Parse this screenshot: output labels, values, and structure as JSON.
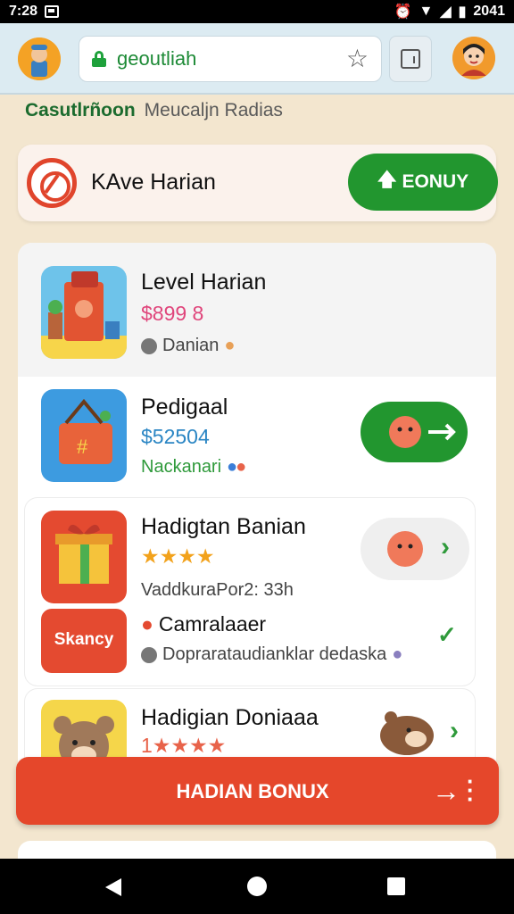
{
  "status_bar": {
    "time": "7:28",
    "right_text": "2041"
  },
  "browser": {
    "url": "geoutliah"
  },
  "site_heading": {
    "part1": "Casutlrñoon",
    "part2": "Meucaljn Radias"
  },
  "daily_card": {
    "title": "KAve Harian",
    "button_label": "EONUY"
  },
  "items": [
    {
      "title": "Level Harian",
      "price": "$899 8",
      "meta": "Danian"
    },
    {
      "title": "Pedigaal",
      "price": "$52504",
      "meta": "Nackanari"
    },
    {
      "title": "Hadigtan Banian",
      "rating": "★★★★",
      "meta": "VaddkuraPor2: 33h"
    },
    {
      "badge": "Skancy",
      "title": "Camralaaer",
      "meta": "Doprarataudianklar dedaska"
    },
    {
      "title": "Hadigian Doniaaa",
      "rating": "1★★★★"
    }
  ],
  "bottom_cta": {
    "label": "HADIAN BONUX"
  },
  "colors": {
    "green": "#22962f",
    "red": "#e5472b",
    "price_pink": "#e0457b",
    "price_blue": "#2b86c4"
  }
}
